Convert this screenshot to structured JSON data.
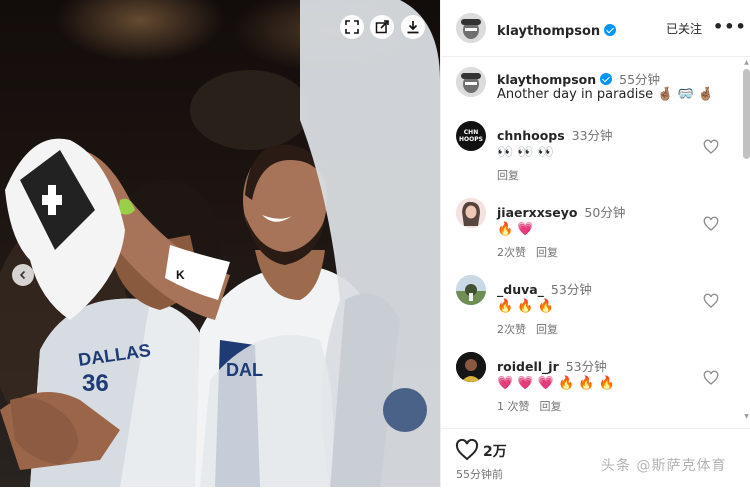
{
  "photo": {
    "fullscreen_icon": "fullscreen-icon",
    "open_external_icon": "open-external-icon",
    "download_icon": "download-icon",
    "prev_icon": "chevron-left-icon",
    "wristband_text": "K",
    "jersey_text_left": "DALLAS",
    "jersey_number_left": "36",
    "jersey_text_right": "DAL"
  },
  "header": {
    "username": "klaythompson",
    "follow_state": "已关注",
    "more_label": "•••"
  },
  "caption": {
    "username": "klaythompson",
    "time": "55分钟",
    "text": "Another day in paradise 🤞🏽 🥽 🤞🏽"
  },
  "comments": [
    {
      "username": "chnhoops",
      "time": "33分钟",
      "text": "👀 👀 👀",
      "likes": "",
      "reply": "回复",
      "avatar_text": "CHN HOOPS"
    },
    {
      "username": "jiaerxxseyo",
      "time": "50分钟",
      "text": "🔥 💗",
      "likes": "2次赞",
      "reply": "回复",
      "avatar_text": ""
    },
    {
      "username": "_duva_",
      "time": "53分钟",
      "text": "🔥 🔥 🔥",
      "likes": "2次赞",
      "reply": "回复",
      "avatar_text": ""
    },
    {
      "username": "roidell_jr",
      "time": "53分钟",
      "text": "💗 💗 💗 🔥 🔥 🔥",
      "likes": "1 次赞",
      "reply": "回复",
      "avatar_text": ""
    }
  ],
  "footer": {
    "likes_count": "2万",
    "post_time": "55分钟前",
    "watermark": "头条 @斯萨克体育"
  },
  "colors": {
    "verified": "#0095f6",
    "text_primary": "#262626",
    "text_secondary": "#737373"
  }
}
